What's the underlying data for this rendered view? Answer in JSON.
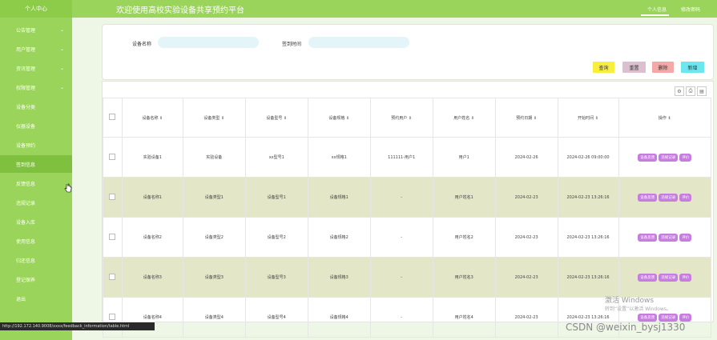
{
  "brand": "个人中心",
  "header_title": "欢迎使用高校实验设备共享预约平台",
  "header_links": [
    "个人信息",
    "修改密码"
  ],
  "sidebar_items": [
    {
      "label": "公告管理",
      "chevron": "⌄"
    },
    {
      "label": "用户管理",
      "chevron": "⌄"
    },
    {
      "label": "资讯管理",
      "chevron": "⌄"
    },
    {
      "label": "权限管理",
      "chevron": "⌄"
    },
    {
      "label": "设备分类",
      "chevron": ""
    },
    {
      "label": "仪器设备",
      "chevron": ""
    },
    {
      "label": "设备预约",
      "chevron": ""
    },
    {
      "label": "签到信息",
      "chevron": ""
    },
    {
      "label": "反馈信息",
      "chevron": ""
    },
    {
      "label": "违规记录",
      "chevron": ""
    },
    {
      "label": "设备入库",
      "chevron": ""
    },
    {
      "label": "使用信息",
      "chevron": ""
    },
    {
      "label": "归还信息",
      "chevron": ""
    },
    {
      "label": "登记保养",
      "chevron": ""
    },
    {
      "label": "退出",
      "chevron": ""
    }
  ],
  "search": {
    "device_name_label": "设备名称",
    "sign_time_label": "签到时间",
    "device_name_value": "",
    "sign_time_value": ""
  },
  "buttons": {
    "query": "查询",
    "reset": "重置",
    "delete": "删除",
    "add": "新增"
  },
  "button_colors": {
    "query": "#f7ef3b",
    "reset": "#dcc0cf",
    "delete": "#f5a8a8",
    "add": "#6ce7ee"
  },
  "table_tool_icons": [
    "settings-icon",
    "print-icon",
    "export-icon"
  ],
  "table_tools": [
    "⚙",
    "⎙",
    "▤"
  ],
  "table": {
    "headers": [
      "设备名称 ⇕",
      "设备类型 ⇕",
      "设备型号 ⇕",
      "设备规格 ⇕",
      "预约用户 ⇕",
      "用户姓名 ⇕",
      "预约日期 ⇕",
      "开始时间 ⇕",
      "操作 ⇕"
    ],
    "rows": [
      [
        "实验设备1",
        "实验设备",
        "xx型号1",
        "xx规格1",
        "111111-用户1",
        "用户1",
        "2024-02-26",
        "2024-02-26 09:00:00"
      ],
      [
        "设备名称1",
        "设备类型1",
        "设备型号1",
        "设备规格1",
        "-",
        "用户姓名1",
        "2024-02-23",
        "2024-02-23 13:26:16"
      ],
      [
        "设备名称2",
        "设备类型2",
        "设备型号2",
        "设备规格2",
        "-",
        "用户姓名2",
        "2024-02-23",
        "2024-02-23 13:26:16"
      ],
      [
        "设备名称3",
        "设备类型3",
        "设备型号3",
        "设备规格3",
        "-",
        "用户姓名3",
        "2024-02-23",
        "2024-02-23 13:26:16"
      ],
      [
        "设备名称4",
        "设备类型4",
        "设备型号4",
        "设备规格4",
        "-",
        "用户姓名4",
        "2024-02-23",
        "2024-02-23 13:26:16"
      ]
    ],
    "ops": [
      "设备反馈",
      "违规记录",
      "评价"
    ]
  },
  "watermark_line1": "激活 Windows",
  "watermark_line2": "转到“设置”以激活 Windows。",
  "csdn_watermark": "CSDN @weixin_bysj1330",
  "status_url": "http://192.172.140.9008/xxxx/feedback_information/table.html"
}
